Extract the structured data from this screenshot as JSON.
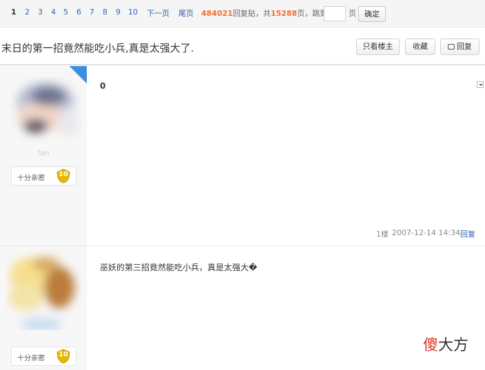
{
  "pager": {
    "pages": [
      {
        "label": "1",
        "current": true
      },
      {
        "label": "2",
        "current": false
      },
      {
        "label": "3",
        "current": false
      },
      {
        "label": "4",
        "current": false
      },
      {
        "label": "5",
        "current": false
      },
      {
        "label": "6",
        "current": false
      },
      {
        "label": "7",
        "current": false
      },
      {
        "label": "8",
        "current": false
      },
      {
        "label": "9",
        "current": false
      },
      {
        "label": "10",
        "current": false
      }
    ],
    "next_label": "下一页",
    "last_label": "尾页",
    "reply_count": "484021",
    "reply_suffix": "回复贴，共",
    "page_total": "15288",
    "page_suffix": "页，跳到",
    "jump_value": "",
    "jump_unit": "页",
    "confirm_label": "确定"
  },
  "thread": {
    "title": "末日的第一招竟然能吃小兵,真是太强大了.",
    "only_op_label": "只看楼主",
    "favorite_label": "收藏",
    "reply_label": "回复"
  },
  "posts": [
    {
      "username": "fan",
      "level_name": "十分亲密",
      "level": "10",
      "content": "0",
      "floor": "1楼",
      "time": "2007-12-14 14:34",
      "reply_label": "回复"
    },
    {
      "level_name": "十分亲密",
      "level": "10",
      "content": "巫妖的第三招竟然能吃小兵，真是太强大�"
    }
  ],
  "watermark": {
    "part1": "傻",
    "part2": "大方"
  },
  "colors": {
    "link": "#2d64b3",
    "count_accent": "#f06f34",
    "badge_blue": "#3b8fe0",
    "level_gold": "#e6b800"
  }
}
